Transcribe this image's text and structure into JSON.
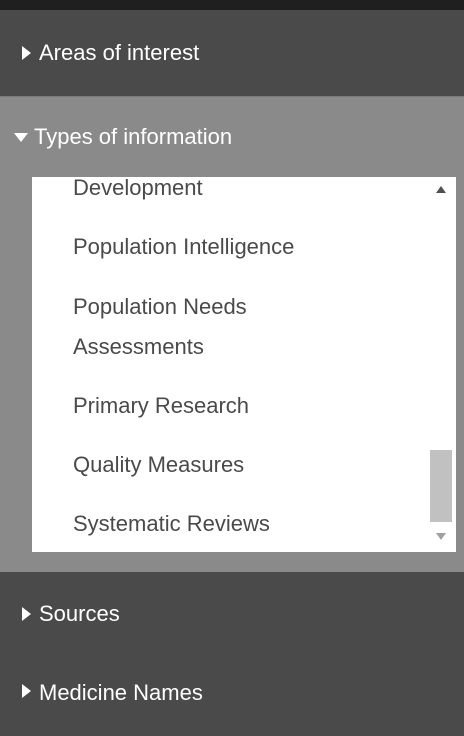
{
  "sections": {
    "areas": {
      "label": "Areas of interest",
      "icon": "triangle-right-icon"
    },
    "types": {
      "label": "Types of information",
      "icon": "triangle-down-icon"
    },
    "sources": {
      "label": "Sources",
      "icon": "triangle-right-icon"
    },
    "medicine": {
      "label": "Medicine Names",
      "icon": "triangle-right-icon"
    }
  },
  "types_list": {
    "items": [
      "Development",
      "Population Intelligence",
      "Population Needs",
      "Assessments",
      "Primary Research",
      "Quality Measures",
      "Systematic Reviews"
    ],
    "scroll_position": 0.88
  },
  "colors": {
    "panel_dark": "#4a4a4a",
    "panel_expanded": "#8a8a8a",
    "list_background": "#ffffff",
    "text_light": "#ffffff",
    "text_dark": "#4a4a4a"
  }
}
